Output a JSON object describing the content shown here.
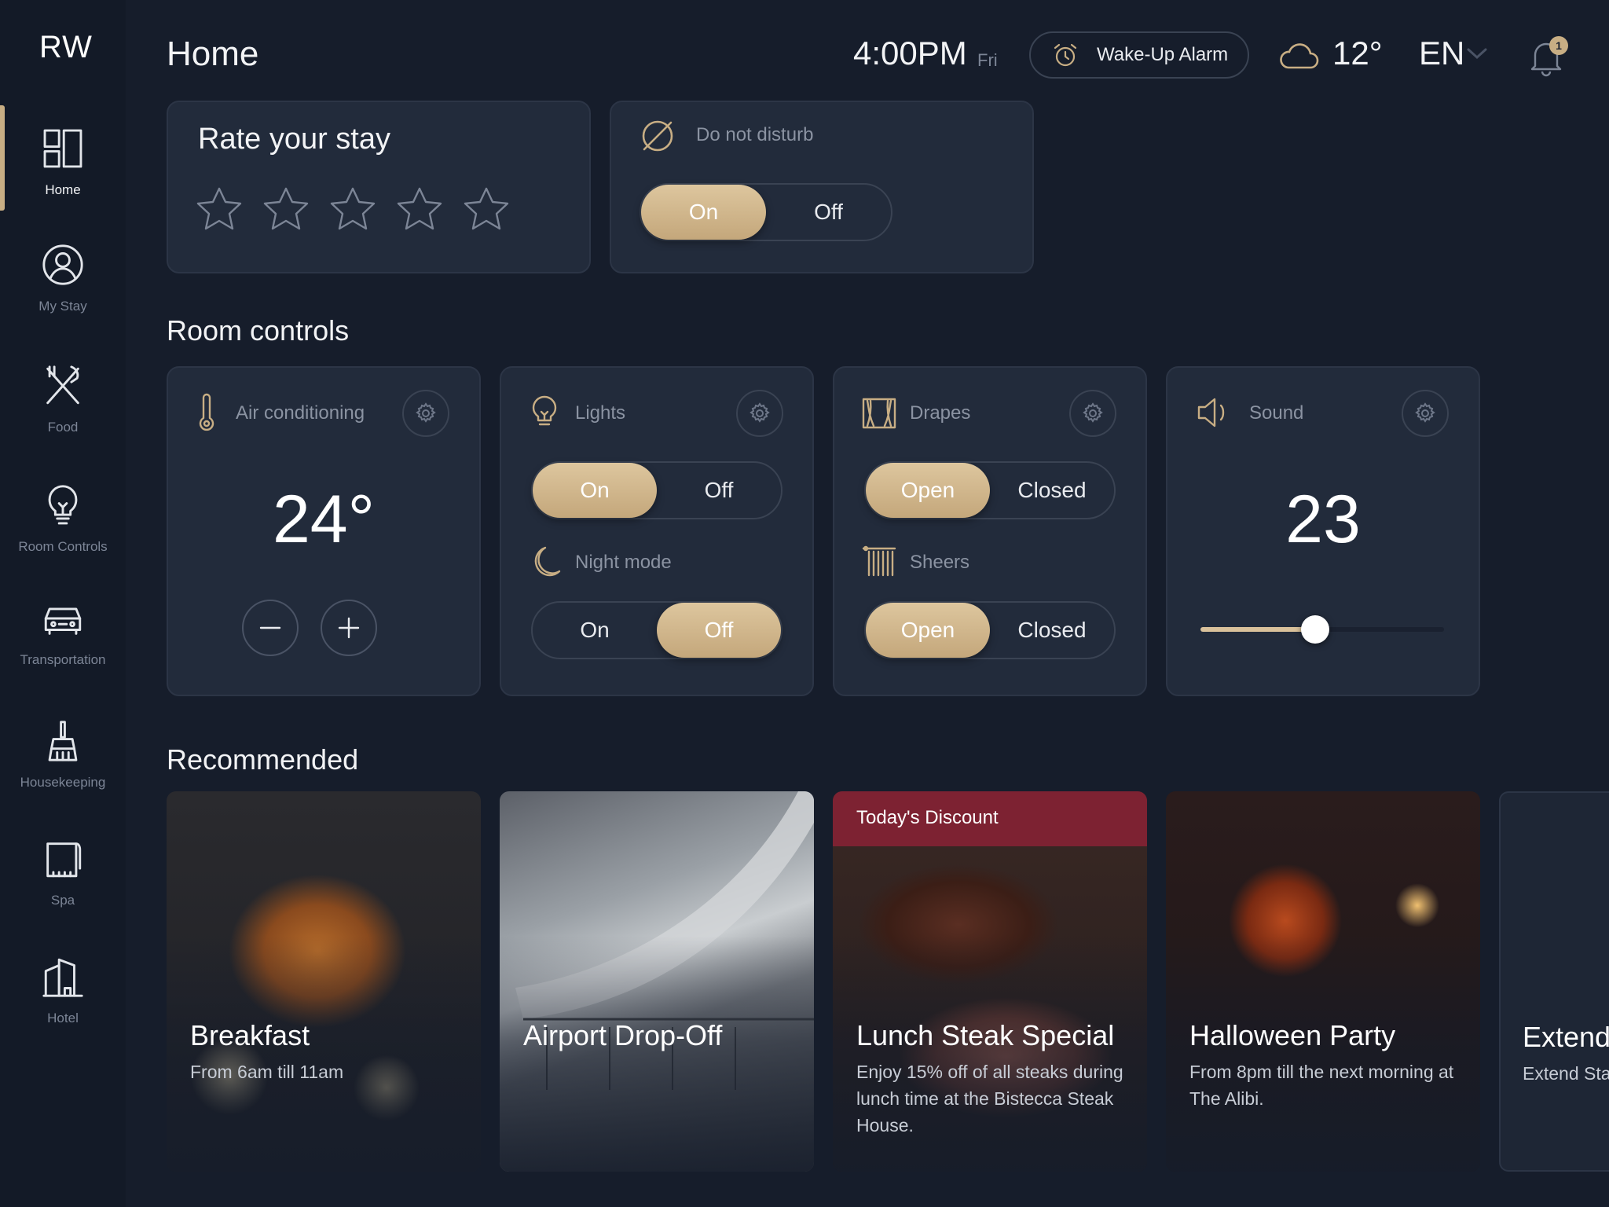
{
  "brand": {
    "logo": "RW",
    "accent_color": "#c8ae84",
    "discount_color": "#7d2232"
  },
  "sidebar": {
    "items": [
      {
        "label": "Home",
        "icon": "home-grid-icon",
        "active": true
      },
      {
        "label": "My Stay",
        "icon": "user-icon",
        "active": false
      },
      {
        "label": "Food",
        "icon": "fork-knife-icon",
        "active": false
      },
      {
        "label": "Room Controls",
        "icon": "lightbulb-icon",
        "active": false
      },
      {
        "label": "Transportation",
        "icon": "car-icon",
        "active": false
      },
      {
        "label": "Housekeeping",
        "icon": "broom-icon",
        "active": false
      },
      {
        "label": "Spa",
        "icon": "towel-icon",
        "active": false
      },
      {
        "label": "Hotel",
        "icon": "building-icon",
        "active": false
      }
    ]
  },
  "header": {
    "title": "Home",
    "time": "4:00PM",
    "day": "Fri",
    "alarm_label": "Wake-Up Alarm",
    "temperature": "12°",
    "weather_icon": "cloud-icon",
    "language": "EN",
    "notification_count": "1"
  },
  "rate": {
    "title": "Rate your stay",
    "stars_total": 5,
    "stars_selected": 0
  },
  "dnd": {
    "label": "Do not disturb",
    "on_label": "On",
    "off_label": "Off",
    "selected": "On"
  },
  "room_controls": {
    "title": "Room controls",
    "air_conditioning": {
      "label": "Air conditioning",
      "value": "24°"
    },
    "lights": {
      "label": "Lights",
      "on_label": "On",
      "off_label": "Off",
      "selected": "On",
      "night_mode": {
        "label": "Night mode",
        "on_label": "On",
        "off_label": "Off",
        "selected": "Off"
      }
    },
    "drapes": {
      "label": "Drapes",
      "open_label": "Open",
      "closed_label": "Closed",
      "selected": "Open",
      "sheers": {
        "label": "Sheers",
        "open_label": "Open",
        "closed_label": "Closed",
        "selected": "Open"
      }
    },
    "sound": {
      "label": "Sound",
      "value": "23",
      "level_fraction": 0.47
    }
  },
  "recommended": {
    "title": "Recommended",
    "items": [
      {
        "title": "Breakfast",
        "subtitle": "From 6am till 11am"
      },
      {
        "title": "Airport Drop-Off",
        "subtitle": ""
      },
      {
        "title": "Lunch Steak Special",
        "subtitle": "Enjoy 15% off of all steaks during lunch time at the Bistecca Steak House.",
        "banner": "Today's Discount"
      },
      {
        "title": "Halloween Party",
        "subtitle": "From 8pm till the next morning at The Alibi."
      },
      {
        "title": "Extend",
        "subtitle": "Extend Sta"
      }
    ]
  }
}
